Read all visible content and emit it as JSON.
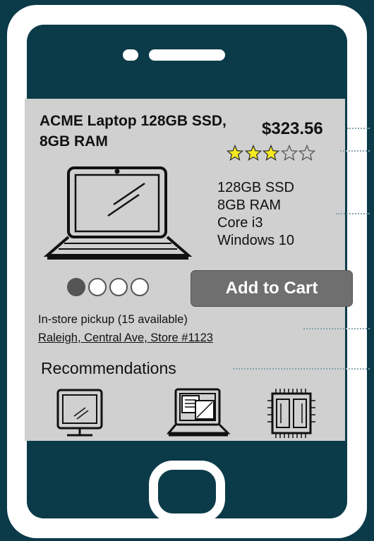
{
  "product": {
    "title": "ACME Laptop 128GB SSD, 8GB RAM",
    "price": "$323.56",
    "rating": 3,
    "rating_max": 5,
    "specs": [
      "128GB SSD",
      "8GB RAM",
      "Core i3",
      "Windows 10"
    ]
  },
  "carousel": {
    "count": 4,
    "active_index": 0
  },
  "cart": {
    "button_label": "Add to Cart"
  },
  "availability": {
    "pickup_text": "In-store pickup (15 available)",
    "store_link": "Raleigh, Central Ave, Store #1123"
  },
  "recommendations": {
    "title": "Recommendations",
    "items": [
      {
        "icon": "monitor-icon"
      },
      {
        "icon": "laptop-document-icon"
      },
      {
        "icon": "memory-chip-icon"
      }
    ]
  },
  "colors": {
    "background": "#0b3a48",
    "screen": "#d0d0d0",
    "button": "#6f6f6f",
    "star": "#f4ea1f"
  }
}
